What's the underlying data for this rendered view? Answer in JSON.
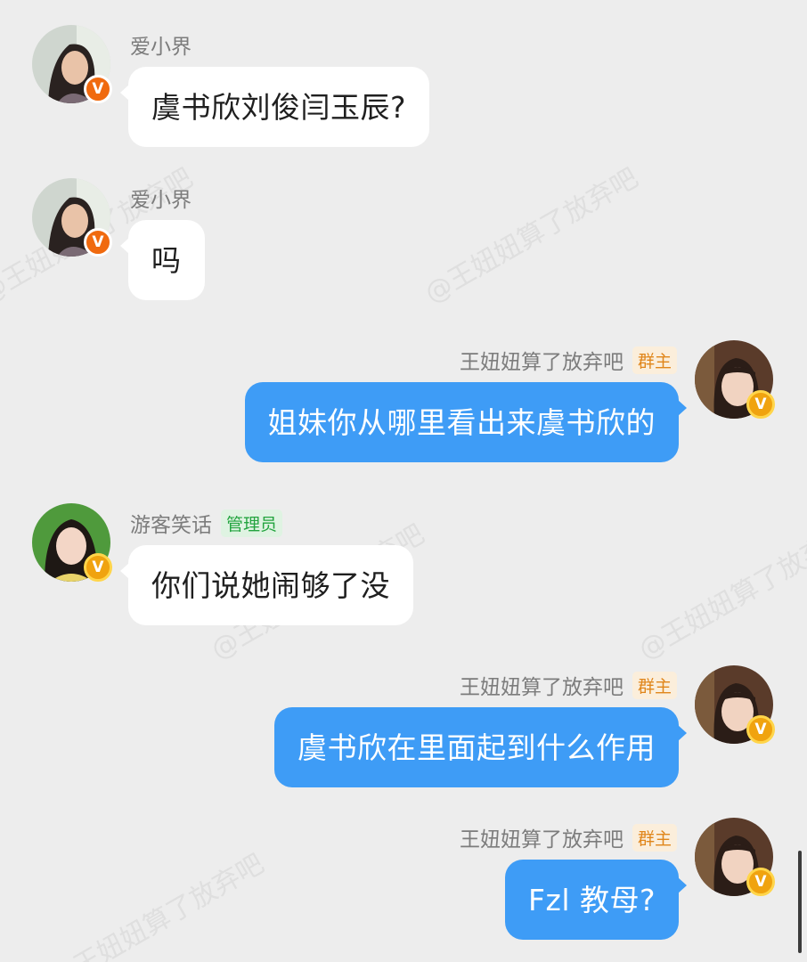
{
  "colors": {
    "background": "#ededed",
    "incoming_bubble": "#ffffff",
    "outgoing_bubble": "#3e9cf6",
    "badge_orange": "#f06a0f",
    "owner_tag": "#e0861b",
    "admin_tag": "#23a43f"
  },
  "watermark": "@王妞妞算了放弃吧",
  "badge_letter": "V",
  "messages": [
    {
      "sender": "爱小界",
      "role": "",
      "text": "虞书欣刘俊闫玉辰?",
      "direction": "incoming",
      "avatar_icon": "woman-avatar-icon"
    },
    {
      "sender": "爱小界",
      "role": "",
      "text": "吗",
      "direction": "incoming",
      "avatar_icon": "woman-avatar-icon"
    },
    {
      "sender": "王妞妞算了放弃吧",
      "role": "群主",
      "text": "姐妹你从哪里看出来虞书欣的",
      "direction": "outgoing",
      "avatar_icon": "girl-avatar-icon"
    },
    {
      "sender": "游客笑话",
      "role": "管理员",
      "text": "你们说她闹够了没",
      "direction": "incoming",
      "avatar_icon": "woman-avatar-icon"
    },
    {
      "sender": "王妞妞算了放弃吧",
      "role": "群主",
      "text": "虞书欣在里面起到什么作用",
      "direction": "outgoing",
      "avatar_icon": "girl-avatar-icon"
    },
    {
      "sender": "王妞妞算了放弃吧",
      "role": "群主",
      "text": "Fzl 教母?",
      "direction": "outgoing",
      "avatar_icon": "girl-avatar-icon"
    }
  ]
}
